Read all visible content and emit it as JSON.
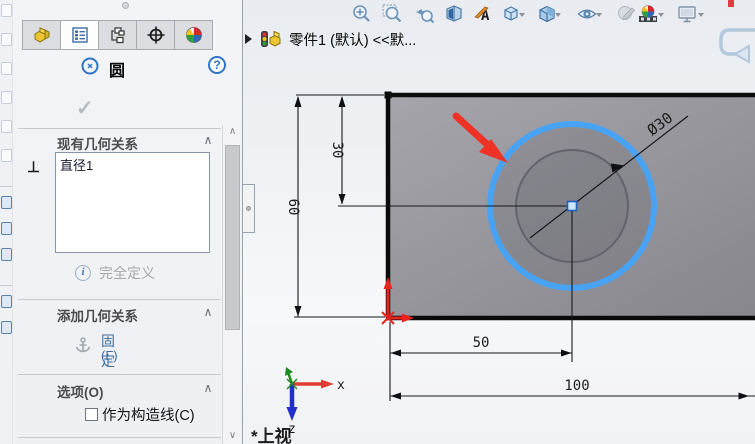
{
  "panel": {
    "tabs": [
      {
        "name": "featuremanager-tab"
      },
      {
        "name": "propertymanager-tab",
        "active": true
      },
      {
        "name": "configurationmanager-tab"
      },
      {
        "name": "dimxpertmanager-tab"
      },
      {
        "name": "displaymanager-tab"
      }
    ],
    "title": "圆",
    "help_label": "?",
    "ok_label": "✓",
    "sections": {
      "existing": {
        "header": "现有几何关系",
        "items": [
          "直径1"
        ]
      },
      "status": {
        "info_glyph": "i",
        "label": "完全定义"
      },
      "add": {
        "header": "添加几何关系",
        "fix_label": "固定",
        "fix_key": "(F)"
      },
      "options": {
        "header": "选项(O)",
        "construction_label": "作为构造线(C)",
        "checked": false
      }
    },
    "scroll": {
      "up": "∧",
      "down": "∨"
    },
    "chevron_up": "∧"
  },
  "toolbar": {
    "icons": [
      "zoom-to-fit",
      "zoom-to-area",
      "previous-view",
      "section-view",
      "annotation-view",
      "view-orientation",
      "display-style",
      "hide-show-items",
      "edit-appearance",
      "apply-scene",
      "view-settings"
    ]
  },
  "viewport": {
    "flyout_part_label": "零件1 (默认) <<默...",
    "view_label": "*上视",
    "dims": {
      "height": "60",
      "offset_y": "30",
      "offset_x": "50",
      "width": "100",
      "diameter": "Ø30"
    },
    "triad": {
      "x": "x",
      "z": "z"
    }
  },
  "colors": {
    "selection_blue": "#49a3f5",
    "annotation_red": "#ee3226",
    "origin_red": "#e8251c",
    "face_gray": "#95959b",
    "link_blue": "#3c6e9f"
  }
}
